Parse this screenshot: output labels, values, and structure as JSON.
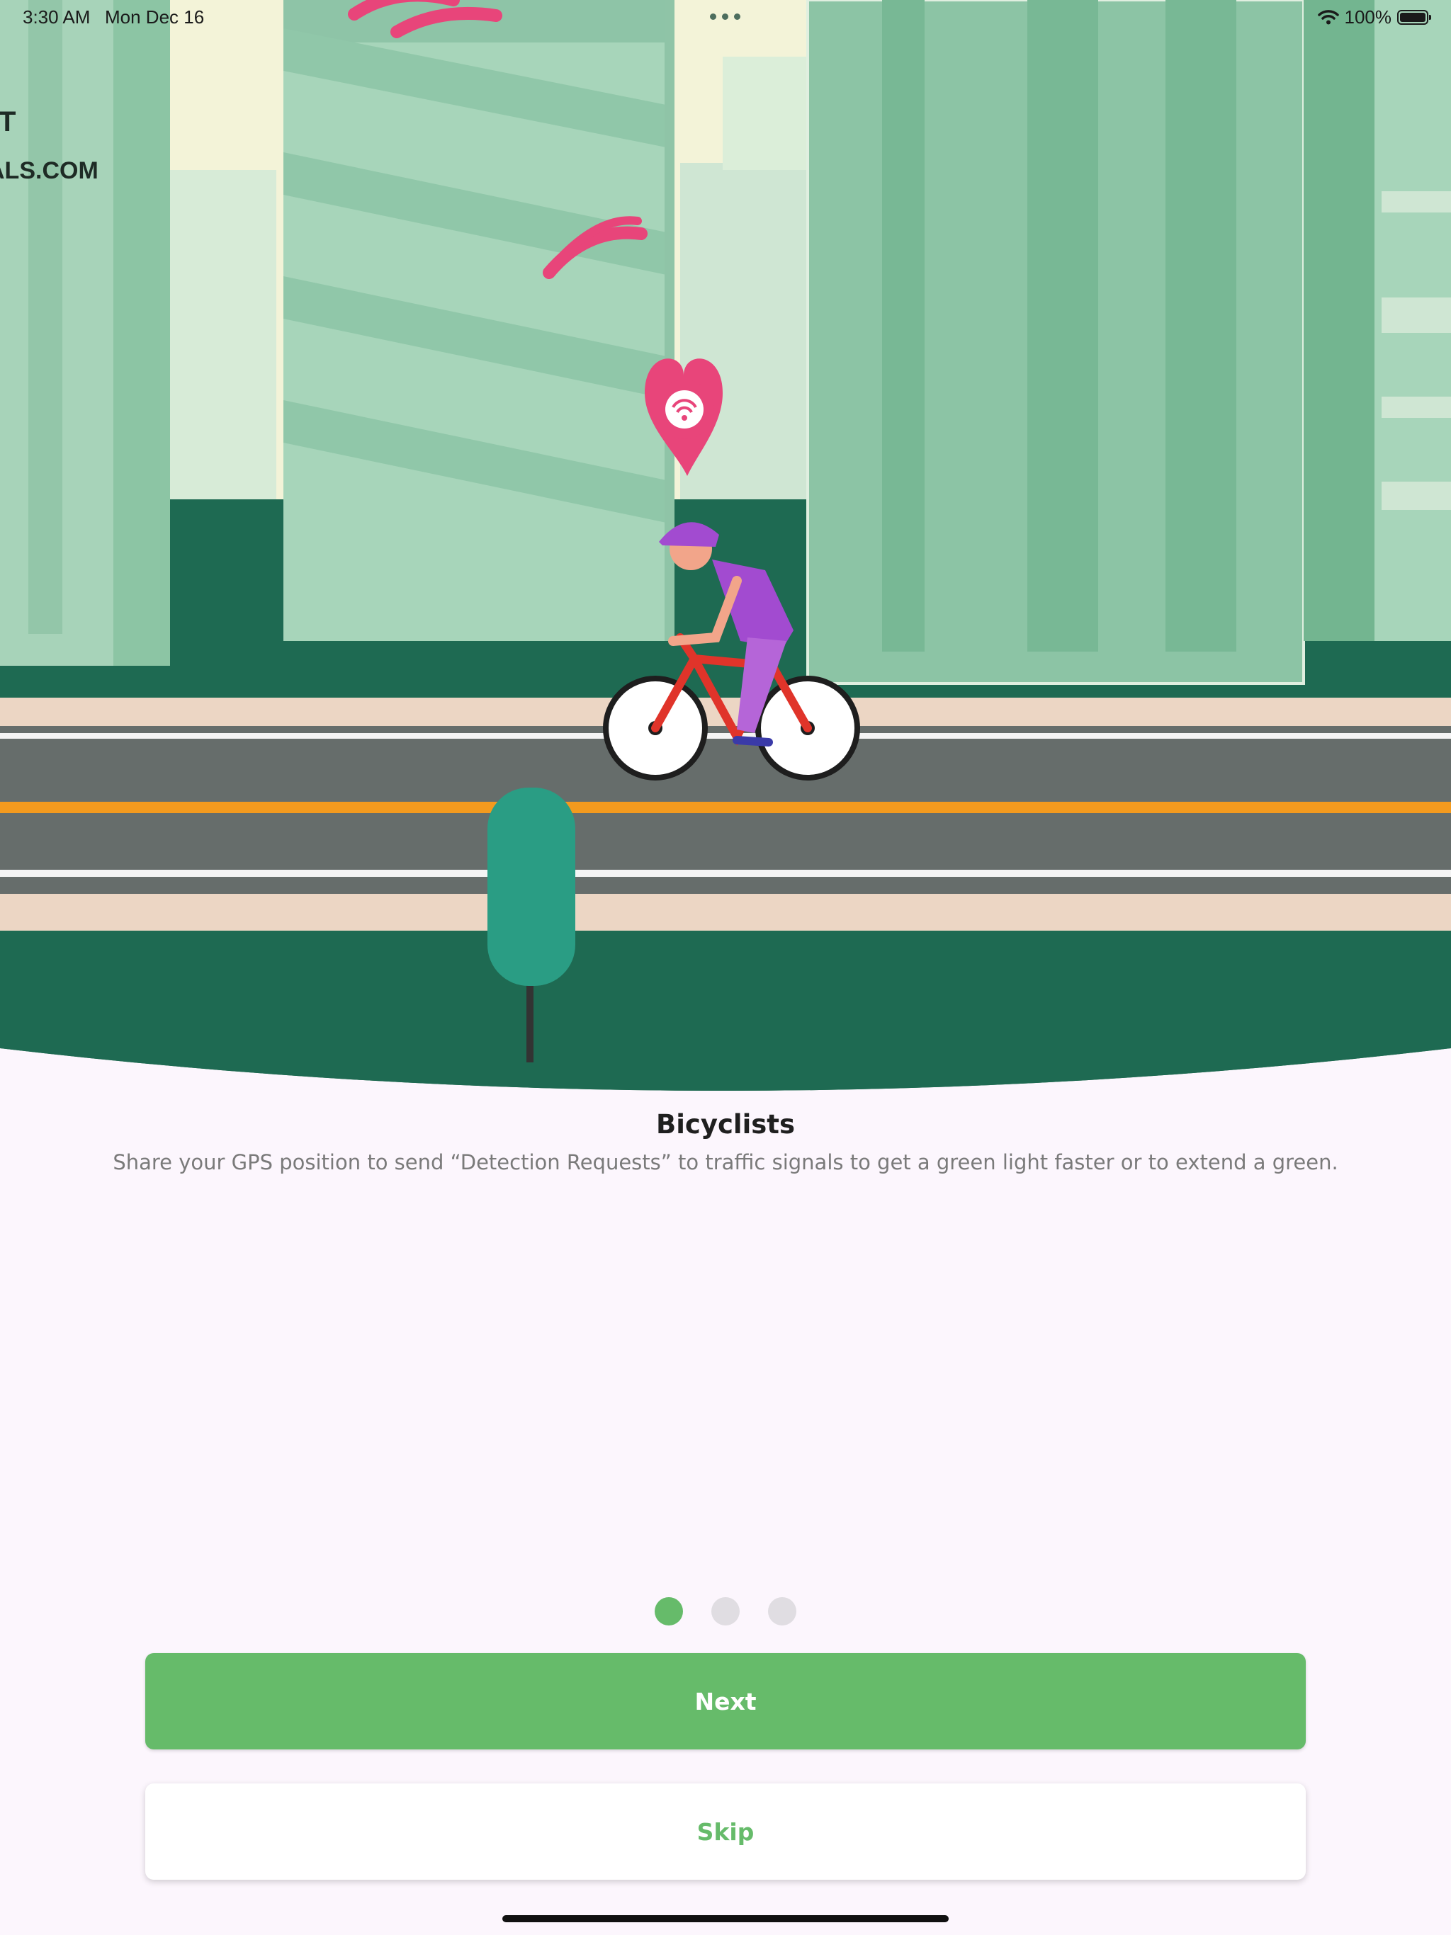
{
  "status_bar": {
    "time": "3:30 AM",
    "date": "Mon Dec 16",
    "battery": "100%"
  },
  "hero": {
    "sign_line_1": "T",
    "sign_line_2": "ALS.COM",
    "icons": [
      "wifi-signal-icon",
      "location-pin-icon",
      "bicyclist-icon",
      "tree-icon"
    ]
  },
  "onboarding": {
    "title": "Bicyclists",
    "description": "Share your GPS position to send “Detection Requests” to traffic signals to get a green light faster or to extend a green.",
    "page_count": 3,
    "current_page": 1
  },
  "buttons": {
    "next": "Next",
    "skip": "Skip"
  },
  "colors": {
    "accent": "#66bb6a",
    "background": "#fcf6fd",
    "dot_inactive": "#e0dde2",
    "road_stripe": "#f39a1e",
    "pin": "#e8457a",
    "dark_green": "#1e6a52"
  }
}
